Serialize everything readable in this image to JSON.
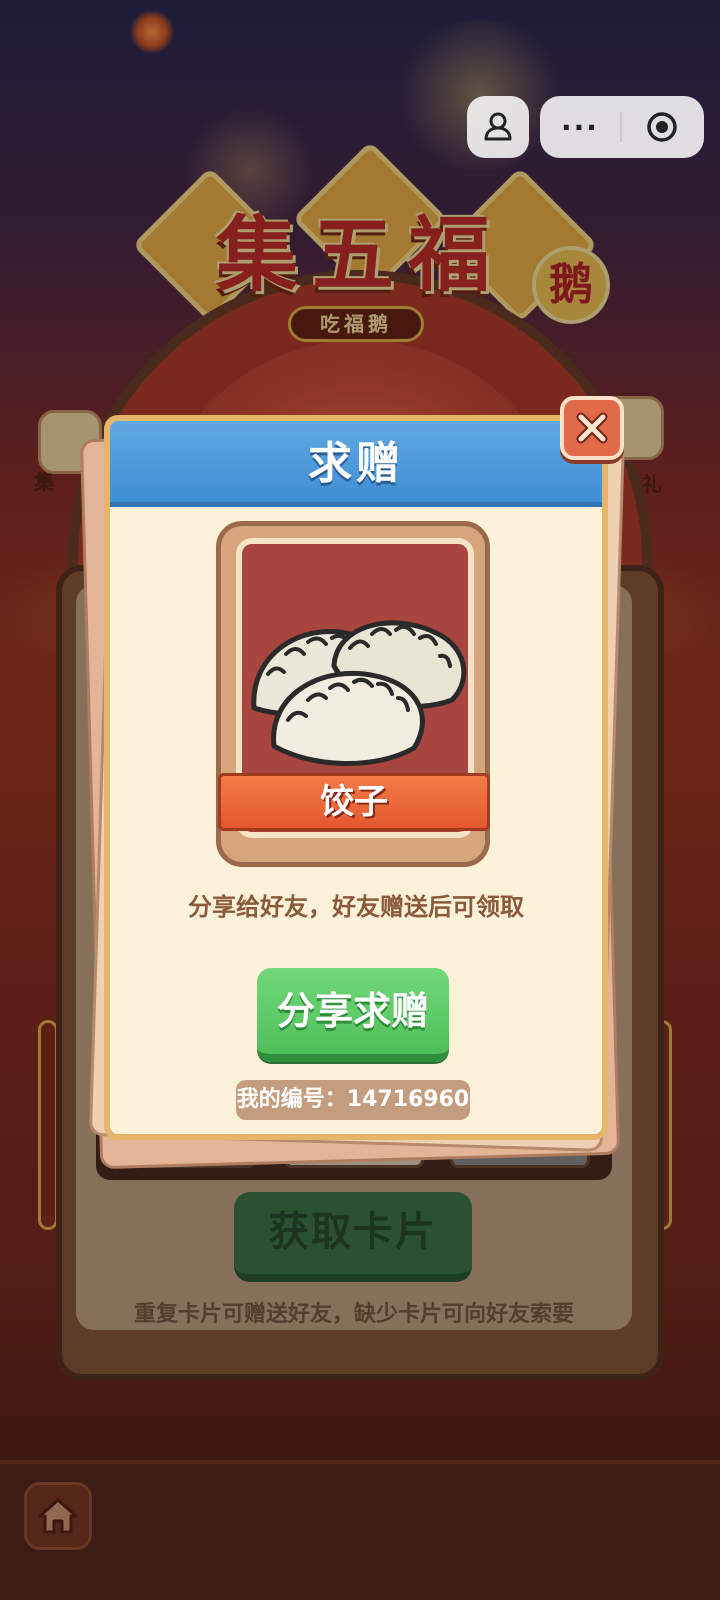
{
  "banner": {
    "title": "集五福",
    "badge": "鹅",
    "subtitle": "吃福鹅"
  },
  "side_labels": {
    "left": "集",
    "right": "礼"
  },
  "capsule": {
    "more_label": "···"
  },
  "board": {
    "get_card_label": "获取卡片",
    "hint": "重复卡片可赠送好友，缺少卡片可向好友索要"
  },
  "modal": {
    "title": "求赠",
    "card_name": "饺子",
    "description": "分享给好友，好友赠送后可领取",
    "share_button": "分享求赠",
    "my_id": "我的编号：14716960"
  },
  "colors": {
    "header_blue": "#3f8ed4",
    "share_green": "#4fbf5a",
    "close_red": "#e06a4a",
    "card_red": "#a8453f"
  },
  "icons": [
    "person-icon",
    "more-icon",
    "target-icon",
    "close-icon",
    "home-icon",
    "dumpling-icon"
  ]
}
